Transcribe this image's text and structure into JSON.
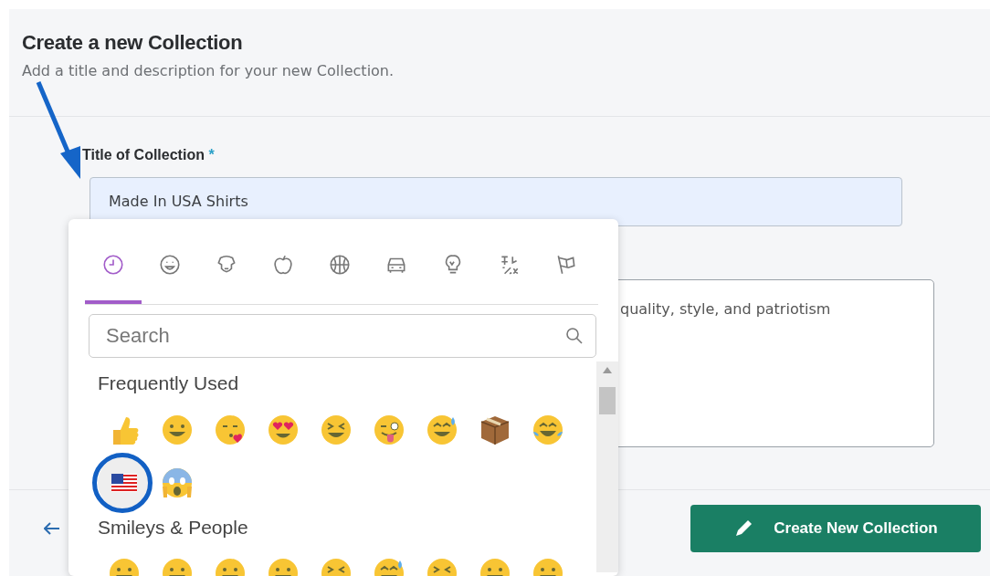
{
  "header": {
    "title": "Create a new Collection",
    "subtitle": "Add a title and description for your new Collection."
  },
  "title_field": {
    "label": "Title of Collection",
    "required_mark": "*",
    "value": "Made In USA Shirts"
  },
  "description_field": {
    "value": "quality, style, and patriotism"
  },
  "submit_button": {
    "label": "Create New Collection"
  },
  "emoji_picker": {
    "tabs": [
      {
        "kind": "clock",
        "selected": true
      },
      {
        "kind": "smiley",
        "selected": false
      },
      {
        "kind": "dog",
        "selected": false
      },
      {
        "kind": "apple",
        "selected": false
      },
      {
        "kind": "ball",
        "selected": false
      },
      {
        "kind": "car",
        "selected": false
      },
      {
        "kind": "bulb",
        "selected": false
      },
      {
        "kind": "symbols",
        "selected": false
      },
      {
        "kind": "flags",
        "selected": false
      }
    ],
    "search": {
      "placeholder": "Search"
    },
    "sections": [
      {
        "title": "Frequently Used",
        "emojis": [
          {
            "kind": "thumbs"
          },
          {
            "kind": "grin"
          },
          {
            "kind": "kiss"
          },
          {
            "kind": "hearteyes"
          },
          {
            "kind": "squint"
          },
          {
            "kind": "wink"
          },
          {
            "kind": "sweat"
          },
          {
            "kind": "box"
          },
          {
            "kind": "tears"
          },
          {
            "kind": "flag",
            "circled": true
          },
          {
            "kind": "scream"
          }
        ]
      },
      {
        "title": "Smileys & People",
        "emojis": [
          {
            "kind": "grin"
          },
          {
            "kind": "grin"
          },
          {
            "kind": "grin"
          },
          {
            "kind": "grin"
          },
          {
            "kind": "squint"
          },
          {
            "kind": "sweat"
          },
          {
            "kind": "squint"
          },
          {
            "kind": "grin"
          },
          {
            "kind": "grin"
          }
        ]
      }
    ]
  }
}
